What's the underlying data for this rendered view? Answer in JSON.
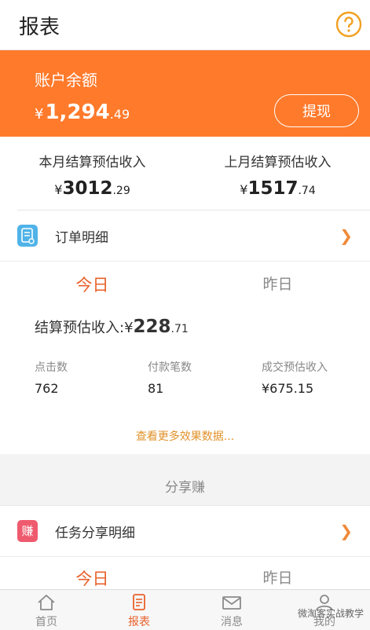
{
  "header": {
    "title": "报表"
  },
  "balance": {
    "label": "账户余额",
    "currency": "¥",
    "int": "1,294",
    "dec": ".49",
    "withdraw_label": "提现"
  },
  "monthly": {
    "this_month": {
      "label": "本月结算预估收入",
      "currency": "¥",
      "int": "3012",
      "dec": ".29"
    },
    "last_month": {
      "label": "上月结算预估收入",
      "currency": "¥",
      "int": "1517",
      "dec": ".74"
    }
  },
  "order_detail": {
    "label": "订单明细"
  },
  "stats": {
    "tabs": [
      "今日",
      "昨日"
    ],
    "settle_label": "结算预估收入:",
    "settle_currency": "¥",
    "settle_int": "228",
    "settle_dec": ".71",
    "metrics": [
      {
        "title": "点击数",
        "value": "762"
      },
      {
        "title": "付款笔数",
        "value": "81"
      },
      {
        "title": "成交预估收入",
        "value": "¥675.15"
      }
    ],
    "more_label": "查看更多效果数据..."
  },
  "share": {
    "section_title": "分享赚",
    "icon_char": "赚",
    "detail_label": "任务分享明细",
    "tabs": [
      "今日",
      "昨日"
    ]
  },
  "bottom_nav": [
    {
      "label": "首页",
      "icon": "home-icon"
    },
    {
      "label": "报表",
      "icon": "report-icon"
    },
    {
      "label": "消息",
      "icon": "mail-icon"
    },
    {
      "label": "我的",
      "icon": "user-icon"
    }
  ],
  "watermark": "微淘客实战教学",
  "colors": {
    "accent": "#ff7a2b",
    "active": "#e8612a",
    "link": "#e0922b"
  }
}
